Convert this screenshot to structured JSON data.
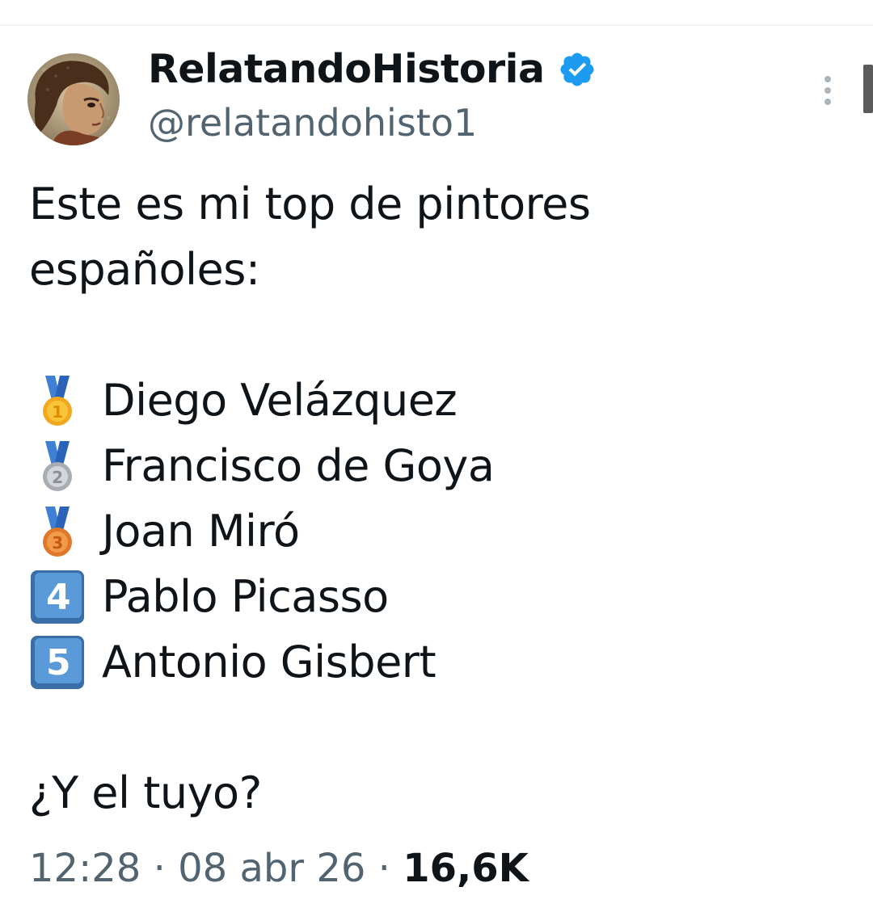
{
  "author": {
    "display_name": "RelatandoHistoria",
    "handle": "@relatandohisto1",
    "verified_icon": "verified-badge-icon",
    "avatar": "avatar-painting"
  },
  "tweet": {
    "intro_line1": "Este es mi top de pintores",
    "intro_line2": "españoles:",
    "ranking": [
      {
        "icon": "gold-medal-icon",
        "number": "1",
        "name": "Diego Velázquez"
      },
      {
        "icon": "silver-medal-icon",
        "number": "2",
        "name": "Francisco de Goya"
      },
      {
        "icon": "bronze-medal-icon",
        "number": "3",
        "name": "Joan Miró"
      },
      {
        "icon": "keycap-4-icon",
        "number": "4",
        "name": "Pablo Picasso"
      },
      {
        "icon": "keycap-5-icon",
        "number": "5",
        "name": "Antonio Gisbert"
      }
    ],
    "question": "¿Y el tuyo?"
  },
  "meta": {
    "time": "12:28",
    "separator": " · ",
    "date": "08 abr 26",
    "views": "16,6K"
  },
  "colors": {
    "text": "#0f1419",
    "secondary": "#536471",
    "verified": "#1d9bf0"
  }
}
